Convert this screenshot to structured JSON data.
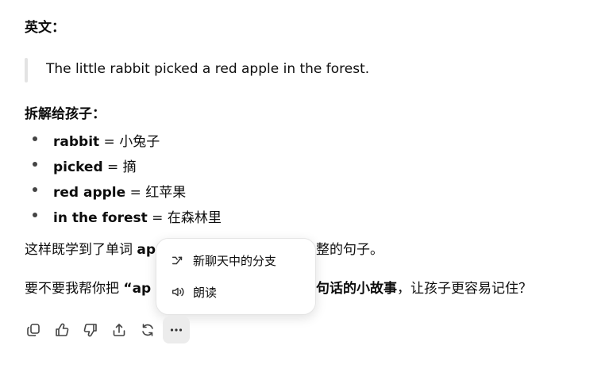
{
  "section_english": {
    "heading": "英文：",
    "sentence": "The little rabbit picked a red apple in the forest."
  },
  "section_breakdown": {
    "heading": "拆解给孩子：",
    "items": [
      {
        "word": "rabbit",
        "meaning": " = 小兔子"
      },
      {
        "word": "picked",
        "meaning": " = 摘"
      },
      {
        "word": "red apple",
        "meaning": " = 红苹果"
      },
      {
        "word": "in the forest",
        "meaning": " = 在森林里"
      }
    ]
  },
  "para1": {
    "lead": "这样既学到了单词 ",
    "bold": "ap",
    "tail": "整的句子。"
  },
  "para2": {
    "lead": "要不要我帮你把 ",
    "bold_a": "“ap",
    "bold_b": "句话的小故事",
    "tail": "，让孩子更容易记住？"
  },
  "context_menu": {
    "items": [
      {
        "label": "新聊天中的分支",
        "icon": "branch-icon"
      },
      {
        "label": "朗读",
        "icon": "speaker-icon"
      }
    ]
  },
  "actions": [
    "copy-icon",
    "thumbs-up-icon",
    "thumbs-down-icon",
    "share-icon",
    "regenerate-icon",
    "more-icon"
  ]
}
